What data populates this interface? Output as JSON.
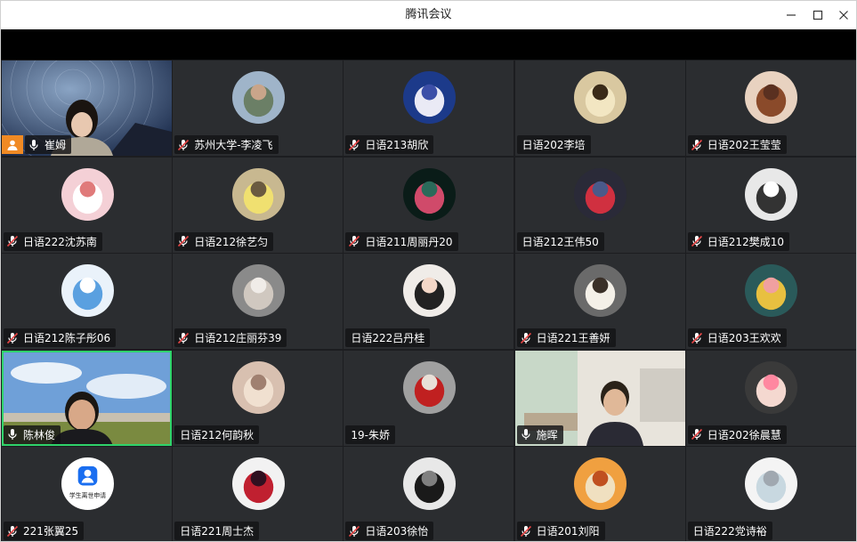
{
  "window": {
    "title": "腾讯会议"
  },
  "colors": {
    "accent_host": "#f08a24",
    "speaking_border": "#2fd36a",
    "tile_bg": "#2b2d30"
  },
  "participants": [
    {
      "name": "崔姆",
      "mic": "on",
      "host": true,
      "view": "video"
    },
    {
      "name": "苏州大学-李凌飞",
      "mic": "muted",
      "view": "avatar"
    },
    {
      "name": "日语213胡欣",
      "mic": "muted",
      "view": "avatar"
    },
    {
      "name": "日语202李培",
      "mic": "none",
      "view": "avatar"
    },
    {
      "name": "日语202王莹莹",
      "mic": "muted",
      "view": "avatar"
    },
    {
      "name": "日语222沈苏南",
      "mic": "muted",
      "view": "avatar"
    },
    {
      "name": "日语212徐艺匀",
      "mic": "muted",
      "view": "avatar"
    },
    {
      "name": "日语211周丽丹20",
      "mic": "muted",
      "view": "avatar"
    },
    {
      "name": "日语212王伟50",
      "mic": "none",
      "view": "avatar"
    },
    {
      "name": "日语212樊成10",
      "mic": "muted",
      "view": "avatar"
    },
    {
      "name": "日语212陈子彤06",
      "mic": "muted",
      "view": "avatar"
    },
    {
      "name": "日语212庄丽芬39",
      "mic": "muted",
      "view": "avatar"
    },
    {
      "name": "日语222吕丹桂",
      "mic": "none",
      "view": "avatar"
    },
    {
      "name": "日语221王善妍",
      "mic": "muted",
      "view": "avatar"
    },
    {
      "name": "日语203王欢欢",
      "mic": "muted",
      "view": "avatar"
    },
    {
      "name": "陈林俊",
      "mic": "on",
      "view": "video",
      "speaking": true
    },
    {
      "name": "日语212何韵秋",
      "mic": "none",
      "view": "avatar"
    },
    {
      "name": "19-朱娇",
      "mic": "none",
      "view": "avatar"
    },
    {
      "name": "施晖",
      "mic": "on",
      "view": "video"
    },
    {
      "name": "日语202徐晨慧",
      "mic": "muted",
      "view": "avatar"
    },
    {
      "name": "221张翼25",
      "mic": "muted",
      "view": "avatar",
      "avatar_text": "学生离世申请"
    },
    {
      "name": "日语221周士杰",
      "mic": "none",
      "view": "avatar"
    },
    {
      "name": "日语203徐怡",
      "mic": "muted",
      "view": "avatar"
    },
    {
      "name": "日语201刘阳",
      "mic": "muted",
      "view": "avatar"
    },
    {
      "name": "日语222党诗裕",
      "mic": "none",
      "view": "avatar"
    }
  ]
}
